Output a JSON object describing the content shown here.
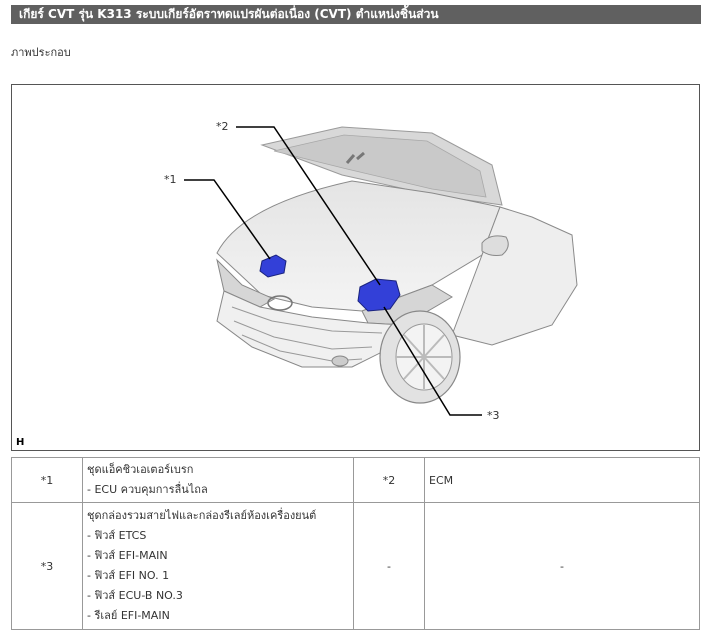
{
  "header": {
    "title": "เกียร์ CVT รุ่น K313  ระบบเกียร์อัตราทดแปรผันต่อเนื่อง (CVT)  ตำแหน่งชิ้นส่วน"
  },
  "section": {
    "subtitle": "ภาพประกอบ"
  },
  "figure": {
    "letter": "H",
    "callouts": [
      "*1",
      "*2",
      "*3"
    ]
  },
  "legend": {
    "rows": [
      {
        "num": "*1",
        "lines": [
          "ชุดแอ็คชิวเอเตอร์เบรก",
          "- ECU ควบคุมการลื่นไถล"
        ],
        "num2": "*2",
        "desc2": "ECM"
      },
      {
        "num": "*3",
        "lines": [
          "ชุดกล่องรวมสายไฟและกล่องรีเลย์ห้องเครื่องยนต์",
          "- ฟิวส์ ETCS",
          "- ฟิวส์ EFI-MAIN",
          "- ฟิวส์ EFI NO. 1",
          "- ฟิวส์ ECU-B NO.3",
          "- รีเลย์ EFI-MAIN"
        ],
        "num2": "-",
        "desc2": "-"
      }
    ]
  },
  "colors": {
    "title_bar": "#606060",
    "component_blue": "#3340d8"
  }
}
